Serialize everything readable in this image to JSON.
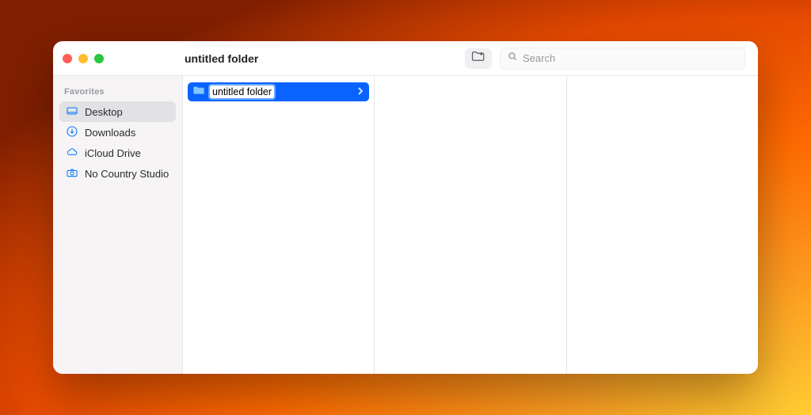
{
  "window": {
    "title": "untitled folder"
  },
  "toolbar": {
    "search_placeholder": "Search"
  },
  "sidebar": {
    "section": "Favorites",
    "items": [
      {
        "label": "Desktop",
        "icon": "desktop",
        "selected": true
      },
      {
        "label": "Downloads",
        "icon": "download",
        "selected": false
      },
      {
        "label": "iCloud Drive",
        "icon": "cloud",
        "selected": false
      },
      {
        "label": "No Country Studio",
        "icon": "camera",
        "selected": false
      }
    ]
  },
  "columns": [
    {
      "items": [
        {
          "label": "untitled folder",
          "editing": true,
          "selected": true
        }
      ]
    },
    {
      "items": []
    },
    {
      "items": []
    }
  ]
}
